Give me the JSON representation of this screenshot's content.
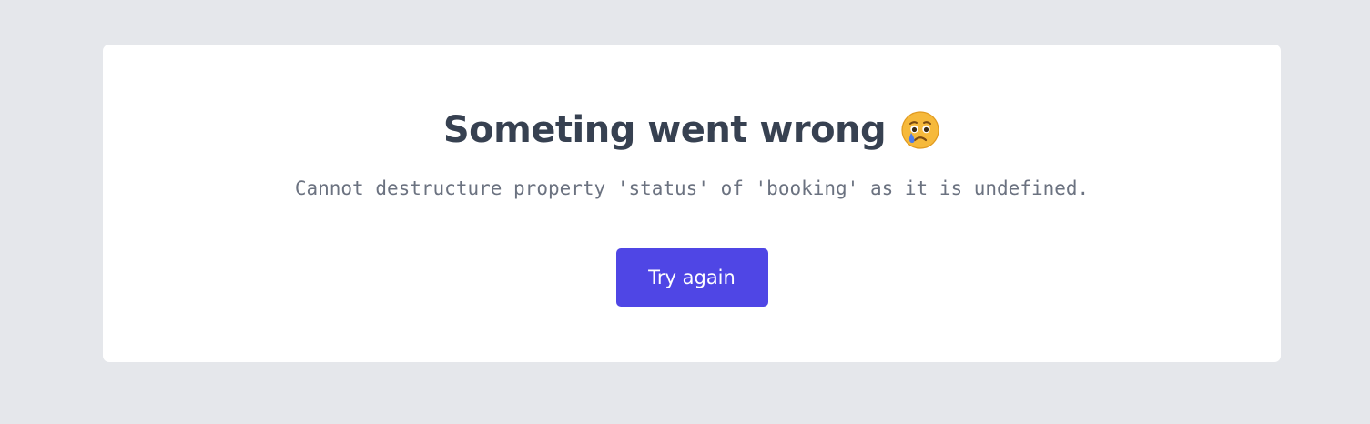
{
  "error": {
    "title": "Someting went wrong",
    "emoji": "crying-face-icon",
    "message": "Cannot destructure property 'status' of 'booking' as it is undefined.",
    "retry_label": "Try again"
  },
  "colors": {
    "page_background": "#e5e7eb",
    "card_background": "#ffffff",
    "title": "#374151",
    "message": "#6b7280",
    "button": "#4f46e5",
    "button_text": "#ffffff"
  }
}
